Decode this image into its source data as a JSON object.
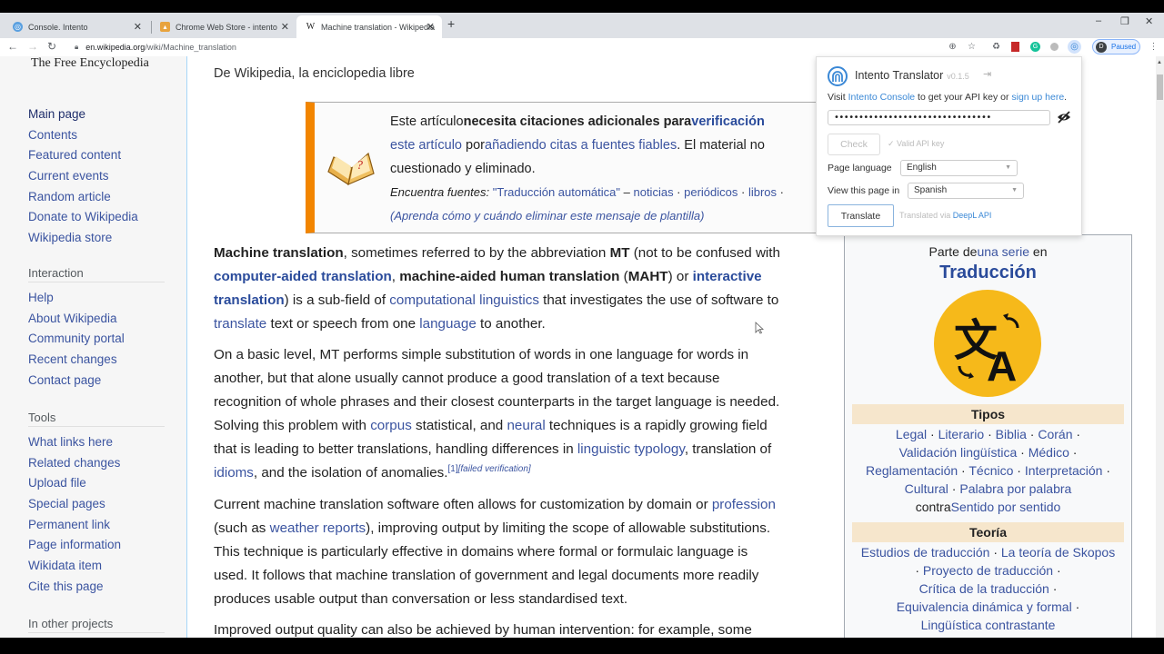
{
  "browser": {
    "tabs": [
      {
        "title": "Console. Intento",
        "icon": "intento-icon",
        "active": false
      },
      {
        "title": "Chrome Web Store - intento",
        "icon": "chrome-web-store-icon",
        "active": false
      },
      {
        "title": "Machine translation - Wikipedia",
        "icon": "wikipedia-w-icon",
        "active": true
      }
    ],
    "new_tab": "+",
    "url_domain": "en.wikipedia.org",
    "url_path": "/wiki/Machine_translation",
    "profile_initial": "D",
    "profile_status": "Paused"
  },
  "sidebar": {
    "tagline": "The Free Encyclopedia",
    "nav": [
      "Main page",
      "Contents",
      "Featured content",
      "Current events",
      "Random article",
      "Donate to Wikipedia",
      "Wikipedia store"
    ],
    "interaction_heading": "Interaction",
    "interaction": [
      "Help",
      "About Wikipedia",
      "Community portal",
      "Recent changes",
      "Contact page"
    ],
    "tools_heading": "Tools",
    "tools": [
      "What links here",
      "Related changes",
      "Upload file",
      "Special pages",
      "Permanent link",
      "Page information",
      "Wikidata item",
      "Cite this page"
    ],
    "other_heading": "In other projects"
  },
  "article": {
    "from": "De Wikipedia, la enciclopedia libre",
    "ambox": {
      "l1_a": "Este artículo",
      "l1_b": "necesita citaciones adicionales para",
      "l1_c": "verificación",
      "l2_a": "este artículo",
      "l2_b": " por",
      "l2_c": "añadiendo citas a fuentes fiables",
      "l2_d": ". El material no",
      "l3": "cuestionado y eliminado.",
      "find_label": "Encuentra fuentes:",
      "find_query": " \"Traducción automática\"",
      "find_dash": " – ",
      "find_links": [
        "noticias",
        "periódicos",
        "libros"
      ],
      "learn": "(Aprenda cómo y cuándo eliminar este mensaje de plantilla)"
    },
    "p1": {
      "b1": "Machine translation",
      "t1": ", sometimes referred to by the abbreviation ",
      "b2": "MT",
      "t2": " (not to be confused with",
      "l1": "computer-aided translation",
      "t3": ", ",
      "b3": "machine-aided human translation",
      "t4": " (",
      "b4": "MAHT",
      "t5": ") or ",
      "l2a": "interactive",
      "l2b": "translation",
      "t6": ") is a sub-field of ",
      "l3": "computational linguistics",
      "t7": " that investigates the use of software to",
      "l4": "translate",
      "t8": " text or speech from one ",
      "l5": "language",
      "t9": " to another."
    },
    "p2": {
      "t1": "On a basic level, MT performs simple substitution of words in one language for words in",
      "t2": "another, but that alone usually cannot produce a good translation of a text because",
      "t3": "recognition of whole phrases and their closest counterparts in the target language is needed.",
      "t4": "Solving this problem with ",
      "l1": "corpus",
      "t5": " statistical, and ",
      "l2": "neural",
      "t6": " techniques is a rapidly growing field",
      "t7": "that is leading to better translations, handling differences in ",
      "l3": "linguistic typology",
      "t8": ", translation of",
      "l4": "idioms",
      "t9": ", and the isolation of anomalies.",
      "ref": "[1]",
      "failed": "[failed verification]"
    },
    "p3": {
      "t1": "Current machine translation software often allows for customization by domain or ",
      "l1": "profession",
      "t2": "(such as ",
      "l2": "weather reports",
      "t3": "), improving output by limiting the scope of allowable substitutions.",
      "t4": "This technique is particularly effective in domains where formal or formulaic language is",
      "t5": "used. It follows that machine translation of government and legal documents more readily",
      "t6": "produces usable output than conversation or less standardised text."
    },
    "p4": "Improved output quality can also be achieved by human intervention: for example, some"
  },
  "infobox": {
    "part_of": "Parte de",
    "series_link": "una serie",
    "part_on": " en",
    "title": "Traducción",
    "types_heading": "Tipos",
    "types": [
      "Legal",
      "Literario",
      "Biblia",
      "Corán",
      "Validación lingüística",
      "Médico",
      "Reglamentación",
      "Técnico",
      "Interpretación",
      "Cultural",
      "Palabra por palabra"
    ],
    "contra": "contra",
    "contra_link": "Sentido por sentido",
    "theory_heading": "Teoría",
    "theory": [
      "Estudios de traducción",
      "La teoría de Skopos",
      "Proyecto de traducción",
      "Crítica de la traducción",
      "Equivalencia dinámica y formal",
      "Lingüística contrastante"
    ]
  },
  "popup": {
    "title": "Intento Translator",
    "version": "v0.1.5",
    "visit": "Visit ",
    "console_link": "Intento Console",
    "visit_mid": " to get your API key or ",
    "signup_link": "sign up here",
    "visit_end": ".",
    "api_key_masked": "••••••••••••••••••••••••••••••••",
    "check": "Check",
    "valid": "✓ Valid API key",
    "page_language_label": "Page language",
    "page_language": "English",
    "view_in_label": "View this page in",
    "view_in": "Spanish",
    "translate": "Translate",
    "via": "Translated via ",
    "via_link": "DeepL API"
  },
  "colors": {
    "link": "#3b54a0",
    "ambox_stripe": "#f28500",
    "logo_yellow": "#f6b91a",
    "popup_link": "#3a88d6"
  }
}
